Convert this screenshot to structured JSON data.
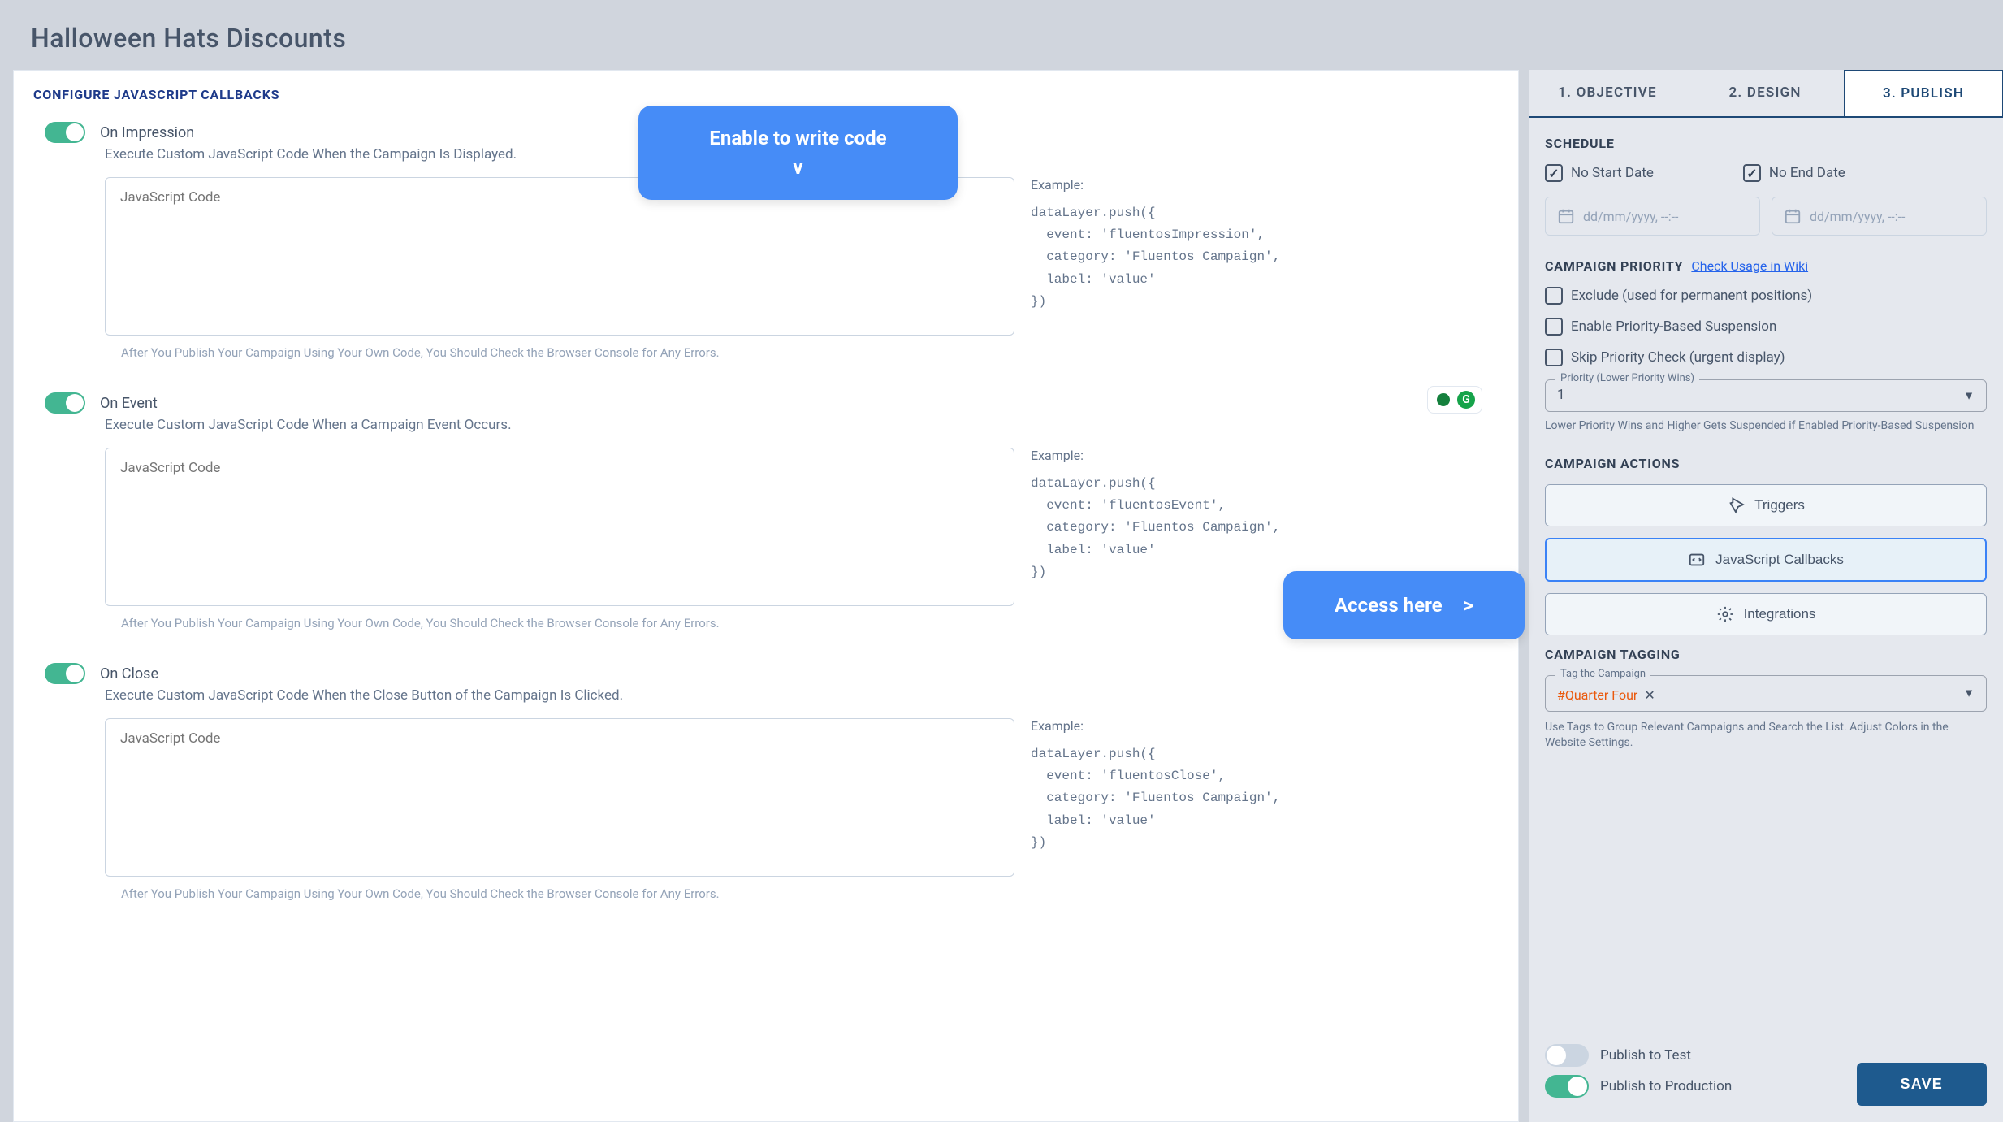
{
  "header": {
    "title": "Halloween Hats Discounts"
  },
  "tabs": [
    {
      "label": "1. OBJECTIVE",
      "active": false
    },
    {
      "label": "2. DESIGN",
      "active": false
    },
    {
      "label": "3. PUBLISH",
      "active": true
    }
  ],
  "panel": {
    "heading": "CONFIGURE JAVASCRIPT CALLBACKS",
    "callbacks": [
      {
        "title": "On Impression",
        "desc": "Execute Custom JavaScript Code When the Campaign Is Displayed.",
        "placeholder": "JavaScript Code",
        "example_label": "Example:",
        "example_code": "dataLayer.push({\n  event: 'fluentosImpression',\n  category: 'Fluentos Campaign',\n  label: 'value'\n})",
        "hint": "After You Publish Your Campaign Using Your Own Code, You Should Check the Browser Console for Any Errors."
      },
      {
        "title": "On Event",
        "desc": "Execute Custom JavaScript Code When a Campaign Event Occurs.",
        "placeholder": "JavaScript Code",
        "example_label": "Example:",
        "example_code": "dataLayer.push({\n  event: 'fluentosEvent',\n  category: 'Fluentos Campaign',\n  label: 'value'\n})",
        "hint": "After You Publish Your Campaign Using Your Own Code, You Should Check the Browser Console for Any Errors."
      },
      {
        "title": "On Close",
        "desc": "Execute Custom JavaScript Code When the Close Button of the Campaign Is Clicked.",
        "placeholder": "JavaScript Code",
        "example_label": "Example:",
        "example_code": "dataLayer.push({\n  event: 'fluentosClose',\n  category: 'Fluentos Campaign',\n  label: 'value'\n})",
        "hint": "After You Publish Your Campaign Using Your Own Code, You Should Check the Browser Console for Any Errors."
      }
    ]
  },
  "schedule": {
    "heading": "SCHEDULE",
    "noStart": "No Start Date",
    "noEnd": "No End Date",
    "placeholder": "dd/mm/yyyy, --:--"
  },
  "priority": {
    "heading": "CAMPAIGN PRIORITY",
    "link": "Check Usage in Wiki",
    "checks": [
      "Exclude (used for permanent positions)",
      "Enable Priority-Based Suspension",
      "Skip Priority Check (urgent display)"
    ],
    "legend": "Priority (Lower Priority Wins)",
    "value": "1",
    "note": "Lower Priority Wins and Higher Gets Suspended if Enabled Priority-Based Suspension"
  },
  "actions": {
    "heading": "CAMPAIGN ACTIONS",
    "triggers": "Triggers",
    "callbacks": "JavaScript Callbacks",
    "integrations": "Integrations"
  },
  "tagging": {
    "heading": "CAMPAIGN TAGGING",
    "legend": "Tag the Campaign",
    "tag": "#Quarter Four",
    "note": "Use Tags to Group Relevant Campaigns and Search the List. Adjust Colors in the Website Settings."
  },
  "footer": {
    "publishTest": "Publish to Test",
    "publishProd": "Publish to Production",
    "save": "SAVE"
  },
  "callouts": {
    "c1": "Enable to write code",
    "c1arrow": "v",
    "c2": "Access here",
    "c2arrow": ">"
  }
}
